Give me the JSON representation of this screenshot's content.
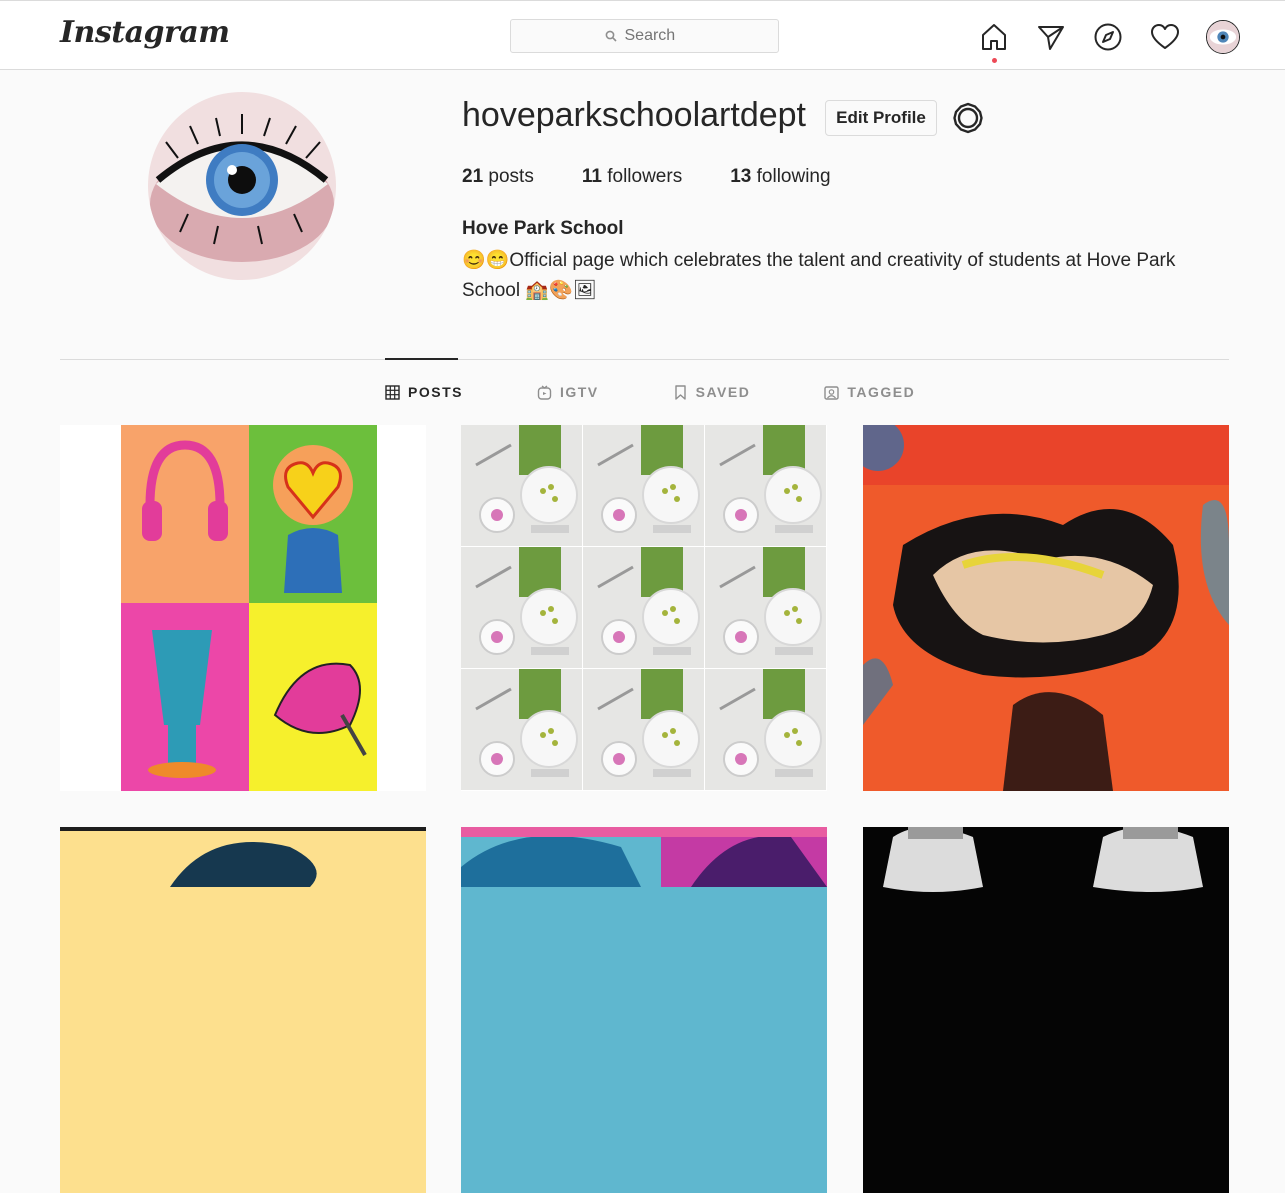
{
  "nav": {
    "logo": "Instagram",
    "search_placeholder": "Search"
  },
  "profile": {
    "username": "hoveparkschoolartdept",
    "edit_label": "Edit Profile",
    "posts_count": "21",
    "posts_label": "posts",
    "followers_count": "11",
    "followers_label": "followers",
    "following_count": "13",
    "following_label": "following",
    "full_name": "Hove Park School",
    "bio": "😊😁Official page which celebrates the talent and creativity of students at Hove Park School 🏫🎨🖼"
  },
  "tabs": [
    {
      "label": "POSTS",
      "icon": "grid-icon",
      "active": true
    },
    {
      "label": "IGTV",
      "icon": "igtv-icon",
      "active": false
    },
    {
      "label": "SAVED",
      "icon": "bookmark-icon",
      "active": false
    },
    {
      "label": "TAGGED",
      "icon": "tagged-icon",
      "active": false
    }
  ],
  "posts": [
    {
      "description": "pop-art four-panel drawing: headphones, heart lamp, jug, hand mixer"
    },
    {
      "description": "3x3 photo collage of teapot, plate, fork and green cutting board"
    },
    {
      "description": "black ink monoprint of a running animal on red-orange collage"
    },
    {
      "description": "dark blue figure on yellow background"
    },
    {
      "description": "colourful leaf collage in teal, pink and purple"
    },
    {
      "description": "black and white splash of milk cups"
    }
  ],
  "colors": {
    "notification_dot": "#ed4956",
    "border": "#dbdbdb",
    "text": "#262626",
    "muted": "#8e8e8e"
  }
}
